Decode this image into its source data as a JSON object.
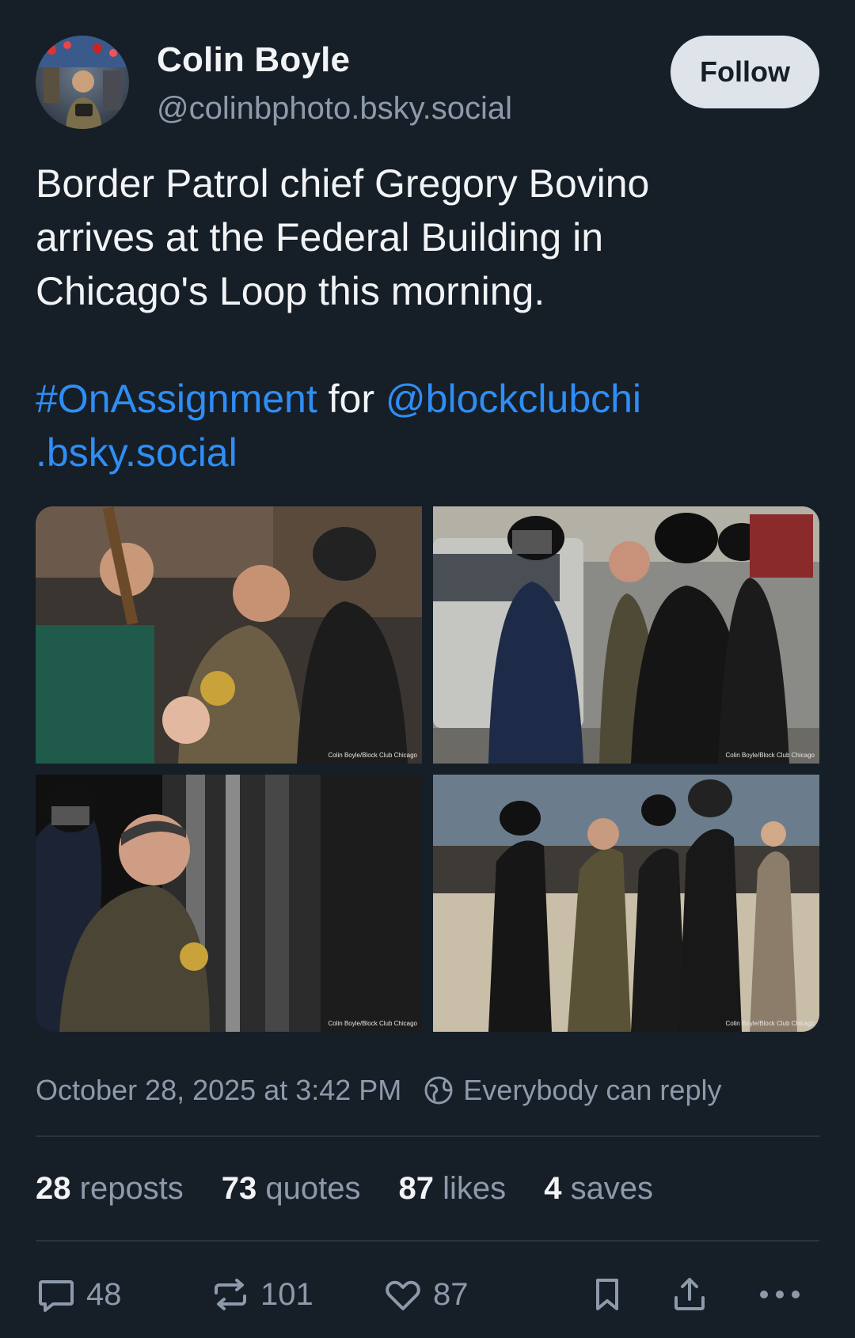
{
  "author": {
    "display_name": "Colin Boyle",
    "handle": "@colinbphoto.bsky.social",
    "avatar_icon": "user-avatar"
  },
  "follow_label": "Follow",
  "post": {
    "line1": "Border Patrol chief Gregory Bovino",
    "line2": "arrives at the Federal Building in",
    "line3": "Chicago's Loop this morning.",
    "hashtag": "#OnAssignment",
    "connector": "for",
    "mention_part1": "@blockclubchi",
    "mention_part2": ".bsky.social"
  },
  "media": {
    "photos": [
      {
        "credit": "Colin Boyle/Block Club Chicago"
      },
      {
        "credit": "Colin Boyle/Block Club Chicago"
      },
      {
        "credit": "Colin Boyle/Block Club Chicago"
      },
      {
        "credit": "Colin Boyle/Block Club Chicago"
      }
    ]
  },
  "meta": {
    "timestamp": "October 28, 2025 at 3:42 PM",
    "reply_setting": "Everybody can reply",
    "reply_icon": "globe-icon"
  },
  "stats": {
    "reposts_count": "28",
    "reposts_label": "reposts",
    "quotes_count": "73",
    "quotes_label": "quotes",
    "likes_count": "87",
    "likes_label": "likes",
    "saves_count": "4",
    "saves_label": "saves"
  },
  "actions": {
    "reply_count": "48",
    "repost_count": "101",
    "like_count": "87"
  },
  "colors": {
    "background": "#161e27",
    "text": "#f1f3f5",
    "muted": "#8d9aab",
    "link": "#2e8ef5",
    "follow_bg": "#dfe4eb"
  }
}
